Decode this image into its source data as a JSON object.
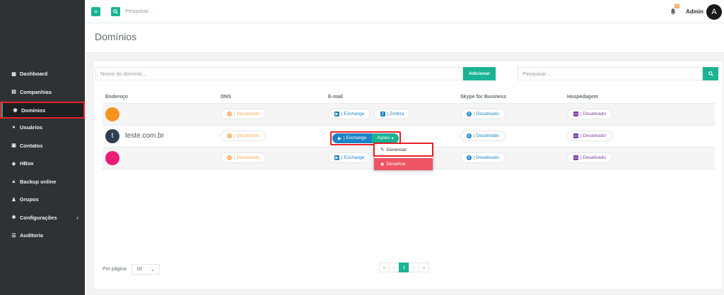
{
  "topbar": {
    "search_placeholder": "Pesquisar...",
    "notification_count": "2",
    "user_name": "Admin",
    "avatar_letter": "A"
  },
  "sidebar": {
    "items": [
      {
        "label": "Dashboard",
        "icon": "grid-icon"
      },
      {
        "label": "Companhias",
        "icon": "building-icon"
      },
      {
        "label": "Domínios",
        "icon": "globe-icon",
        "active": true
      },
      {
        "label": "Usuários",
        "icon": "user-icon"
      },
      {
        "label": "Contatos",
        "icon": "address-card-icon"
      },
      {
        "label": "HBox",
        "icon": "cube-icon"
      },
      {
        "label": "Backup online",
        "icon": "upload-icon"
      },
      {
        "label": "Grupos",
        "icon": "users-icon"
      },
      {
        "label": "Configurações",
        "icon": "gear-icon",
        "has_submenu": true
      },
      {
        "label": "Auditoria",
        "icon": "list-icon"
      }
    ]
  },
  "page": {
    "title": "Domínios",
    "domain_input_placeholder": "Nome do domínio...",
    "add_button": "Adicionar",
    "search_placeholder": "Pesquisar..."
  },
  "table": {
    "headers": [
      "Endereço",
      "DNS",
      "E-mail",
      "Skype for Business",
      "Hospedagem"
    ],
    "rows": [
      {
        "avatar_color": "#f7941d",
        "domain": "",
        "dns": "| Desativado",
        "email": [
          "| Exchange",
          "| Zimbra"
        ],
        "skype": "| Desativado",
        "hosting": "| Desativado"
      },
      {
        "avatar_letter": "t",
        "domain": "teste.com.br",
        "dns": "| Desativado",
        "email": [
          "| Exchange"
        ],
        "email_actions": "Ações",
        "skype": "| Desativado",
        "hosting": "| Desativado"
      },
      {
        "avatar_color": "#ec1c74",
        "domain": "",
        "dns": "| Desativado",
        "email": [
          "| Exchange"
        ],
        "skype": "| Desativado",
        "hosting": "| Desativado"
      }
    ]
  },
  "dropdown": {
    "manage": "Gerenciar",
    "deactivate": "Desativar"
  },
  "footer": {
    "per_page_label": "Por página",
    "per_page_value": "10",
    "pager": [
      "«",
      "‹",
      "1",
      "›",
      "»"
    ]
  },
  "colors": {
    "accent": "#1ab394",
    "blue": "#1c84c6",
    "danger": "#ed5565",
    "sidebar_bg": "#2f3235",
    "highlight": "#e8202a"
  }
}
